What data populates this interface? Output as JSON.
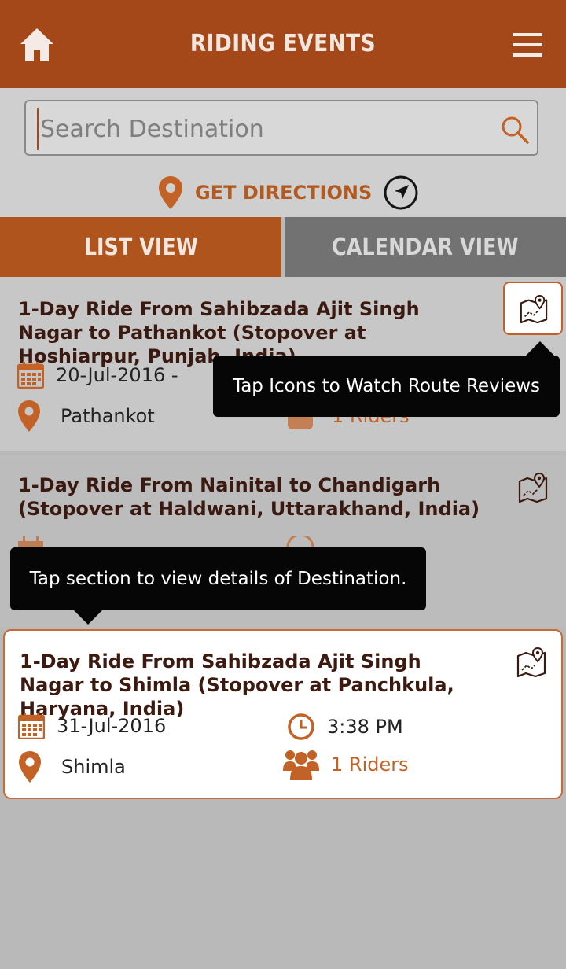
{
  "header": {
    "title": "RIDING EVENTS"
  },
  "search": {
    "placeholder": "Search Destination",
    "directions_label": "GET DIRECTIONS"
  },
  "tabs": {
    "list_label": "LIST VIEW",
    "calendar_label": "CALENDAR VIEW"
  },
  "events": [
    {
      "title": "1-Day Ride From Sahibzada Ajit Singh Nagar to Pathankot (Stopover at Hoshiarpur, Punjab, India)",
      "date": "20-Jul-2016 -",
      "destination": "Pathankot",
      "riders": "1 Riders"
    },
    {
      "title": "1-Day Ride From Nainital to Chandigarh (Stopover at Haldwani, Uttarakhand, India)"
    },
    {
      "title": "1-Day Ride From Sahibzada Ajit Singh Nagar to Shimla (Stopover at Panchkula, Haryana, India)",
      "date": "31-Jul-2016",
      "time": "3:38 PM",
      "destination": "Shimla",
      "riders": "1 Riders"
    }
  ],
  "tooltips": {
    "route_reviews": "Tap Icons to Watch Route Reviews",
    "section_details": "Tap section to view details of Destination."
  },
  "colors": {
    "brand": "#a4481a",
    "accent": "#c36226",
    "tab_inactive": "#727272"
  }
}
